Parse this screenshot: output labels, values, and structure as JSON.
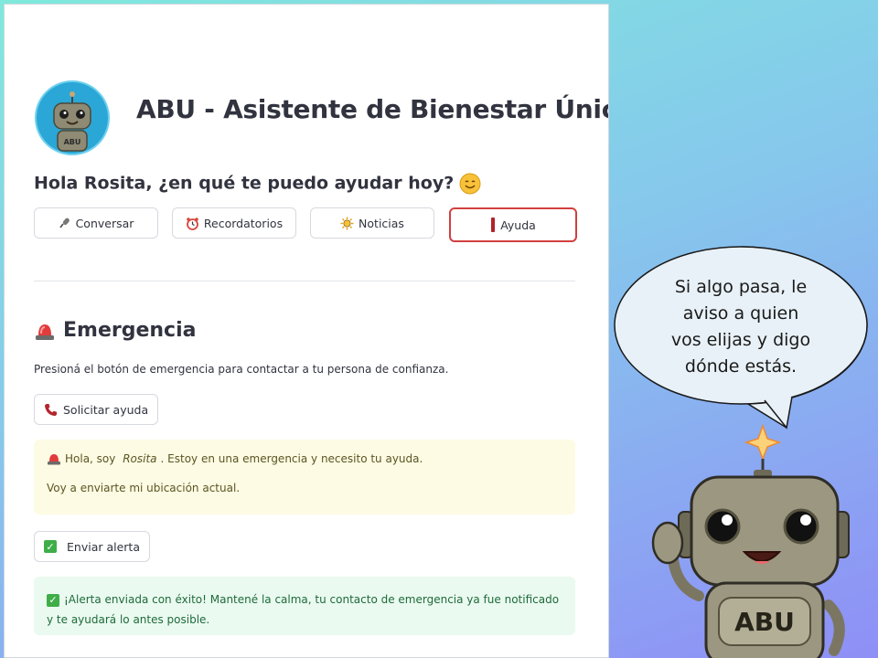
{
  "app": {
    "title": "ABU - Asistente de Bienestar Único",
    "logo_text": "ABU"
  },
  "greeting": "Hola Rosita, ¿en qué te puedo ayudar hoy?",
  "tabs": [
    {
      "label": "Conversar",
      "icon": "microphone-icon",
      "active": false
    },
    {
      "label": "Recordatorios",
      "icon": "alarm-clock-icon",
      "active": false
    },
    {
      "label": "Noticias",
      "icon": "sun-icon",
      "active": false
    },
    {
      "label": "Ayuda",
      "icon": "alert-bar-icon",
      "active": true
    }
  ],
  "emergency": {
    "title": "Emergencia",
    "description": "Presioná el botón de emergencia para contactar a tu persona de confianza.",
    "request_button": "Solicitar ayuda",
    "message_intro": "Hola, soy ",
    "message_name": "Rosita",
    "message_rest": ". Estoy en una emergencia y necesito tu ayuda.",
    "message_line2": "Voy a enviarte mi ubicación actual.",
    "send_button": "Enviar alerta",
    "success_message": "¡Alerta enviada con éxito! Mantené la calma, tu contacto de emergencia ya fue notificado y te ayudará lo antes posible."
  },
  "speech_bubble": {
    "lines": [
      "Si algo pasa, le",
      "aviso a quien",
      "vos elijas y digo",
      "dónde estás."
    ]
  },
  "robot": {
    "badge": "ABU"
  },
  "colors": {
    "active_border": "#d23f3f",
    "warning_bg": "#fdfbe3",
    "success_bg": "#eafaf0",
    "check_green": "#3fae49"
  }
}
